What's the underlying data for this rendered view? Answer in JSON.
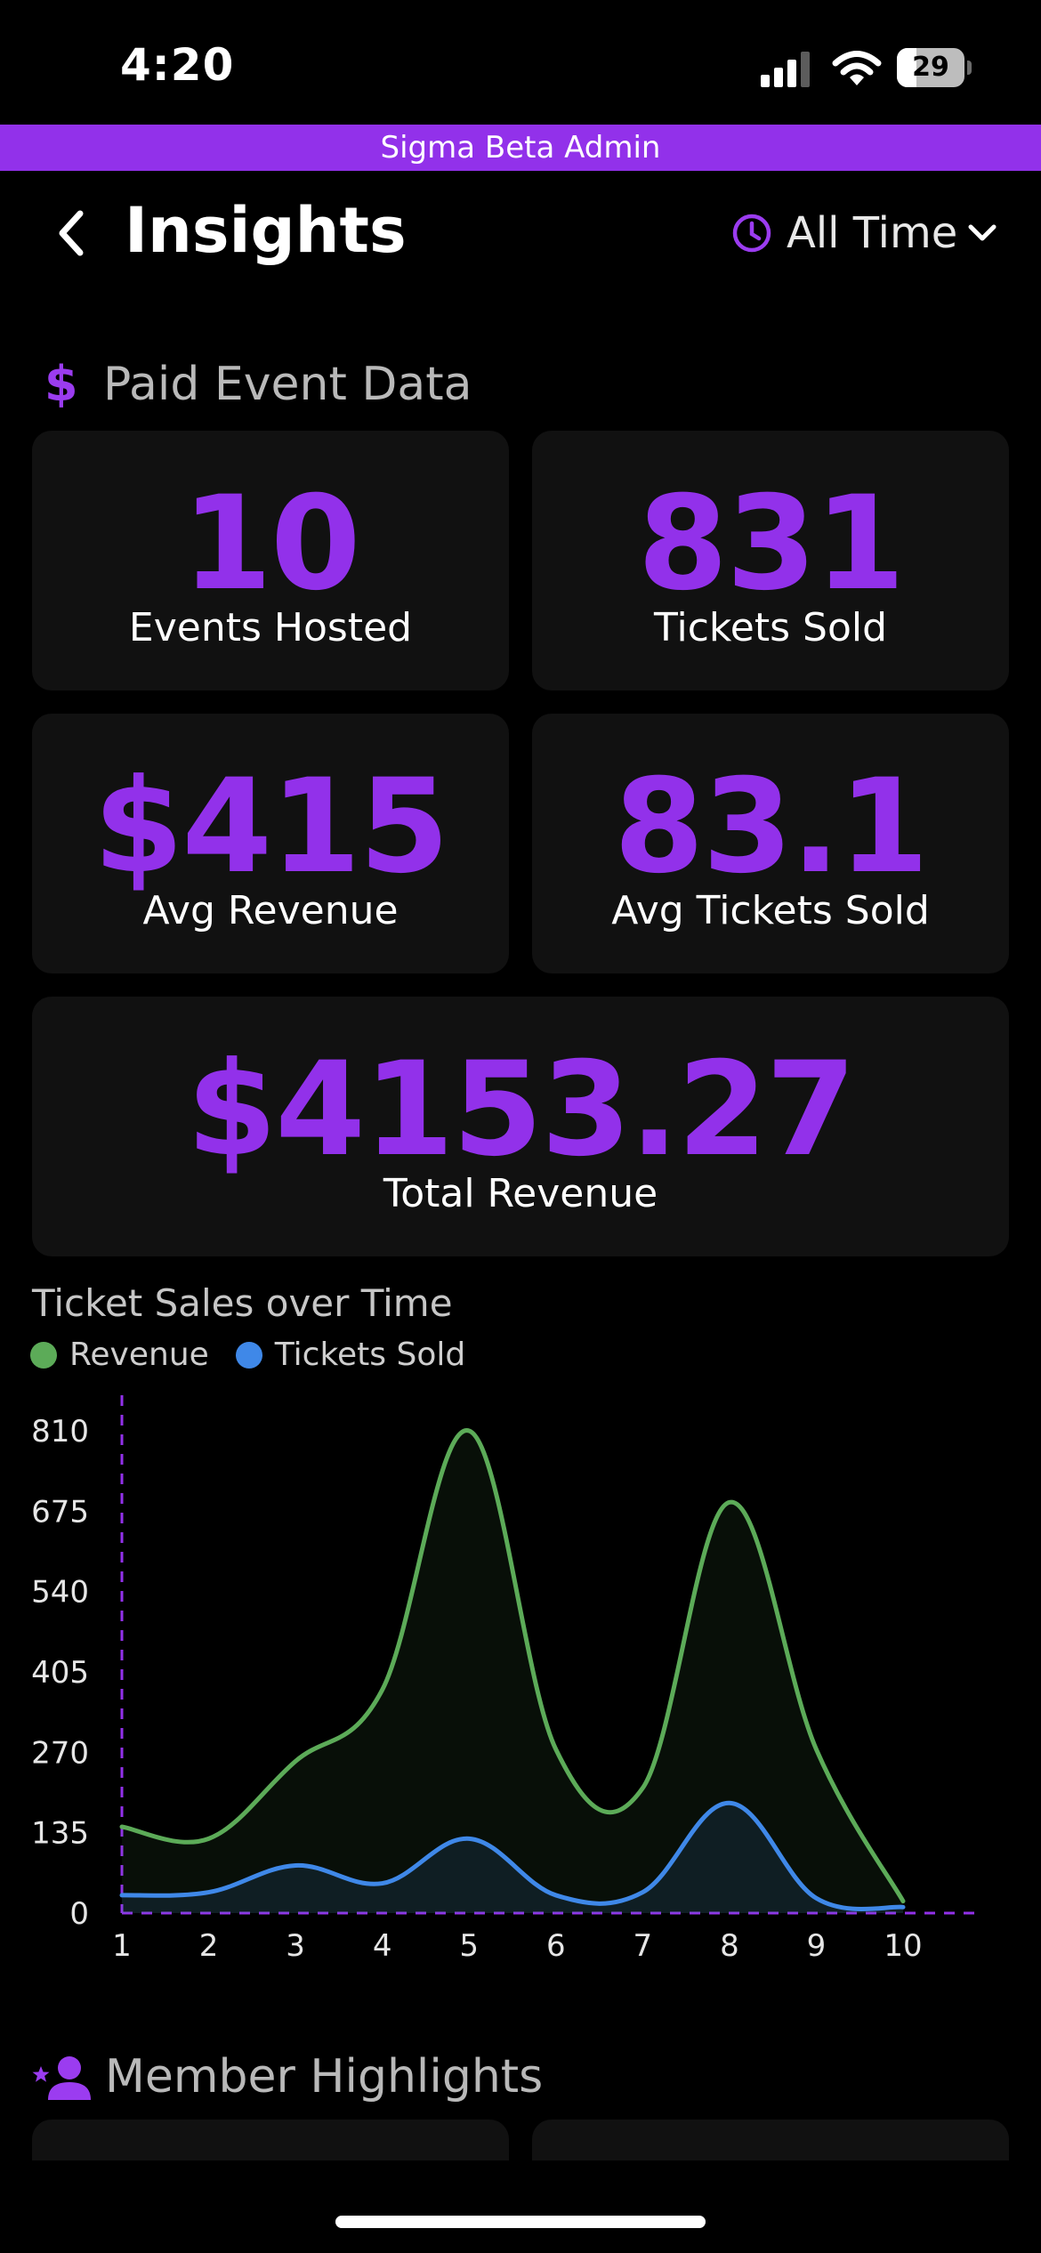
{
  "status_bar": {
    "time": "4:20",
    "battery_level": 29,
    "battery_text": "29"
  },
  "banner": {
    "text": "Sigma Beta Admin"
  },
  "header": {
    "title": "Insights",
    "time_filter": "All Time"
  },
  "paid_section": {
    "title": "Paid Event Data"
  },
  "stats": {
    "events_hosted": {
      "value": "10",
      "label": "Events Hosted"
    },
    "tickets_sold": {
      "value": "831",
      "label": "Tickets Sold"
    },
    "avg_revenue": {
      "value": "$415",
      "label": "Avg Revenue"
    },
    "avg_tickets": {
      "value": "83.1",
      "label": "Avg Tickets Sold"
    },
    "total_revenue": {
      "value": "$4153.27",
      "label": "Total Revenue"
    }
  },
  "chart_title": "Ticket Sales over Time",
  "colors": {
    "accent": "#9231ea",
    "revenue": "#5cab58",
    "tickets": "#3f88e8"
  },
  "chart_data": {
    "type": "area",
    "title": "Ticket Sales over Time",
    "x": [
      1,
      2,
      3,
      4,
      5,
      6,
      7,
      8,
      9,
      10
    ],
    "series": [
      {
        "name": "Revenue",
        "color": "#5cab58",
        "values": [
          145,
          125,
          255,
          375,
          810,
          275,
          210,
          690,
          275,
          20
        ]
      },
      {
        "name": "Tickets Sold",
        "color": "#3f88e8",
        "values": [
          30,
          35,
          80,
          50,
          125,
          30,
          35,
          185,
          25,
          10
        ]
      }
    ],
    "yticks": [
      "0",
      "135",
      "270",
      "405",
      "540",
      "675",
      "810"
    ],
    "xticks": [
      "1",
      "2",
      "3",
      "4",
      "5",
      "6",
      "7",
      "8",
      "9",
      "10"
    ],
    "ylim": [
      0,
      810
    ],
    "xlim": [
      1,
      10
    ],
    "grid": false,
    "legend": "top-left"
  },
  "members_section": {
    "title": "Member Highlights"
  }
}
